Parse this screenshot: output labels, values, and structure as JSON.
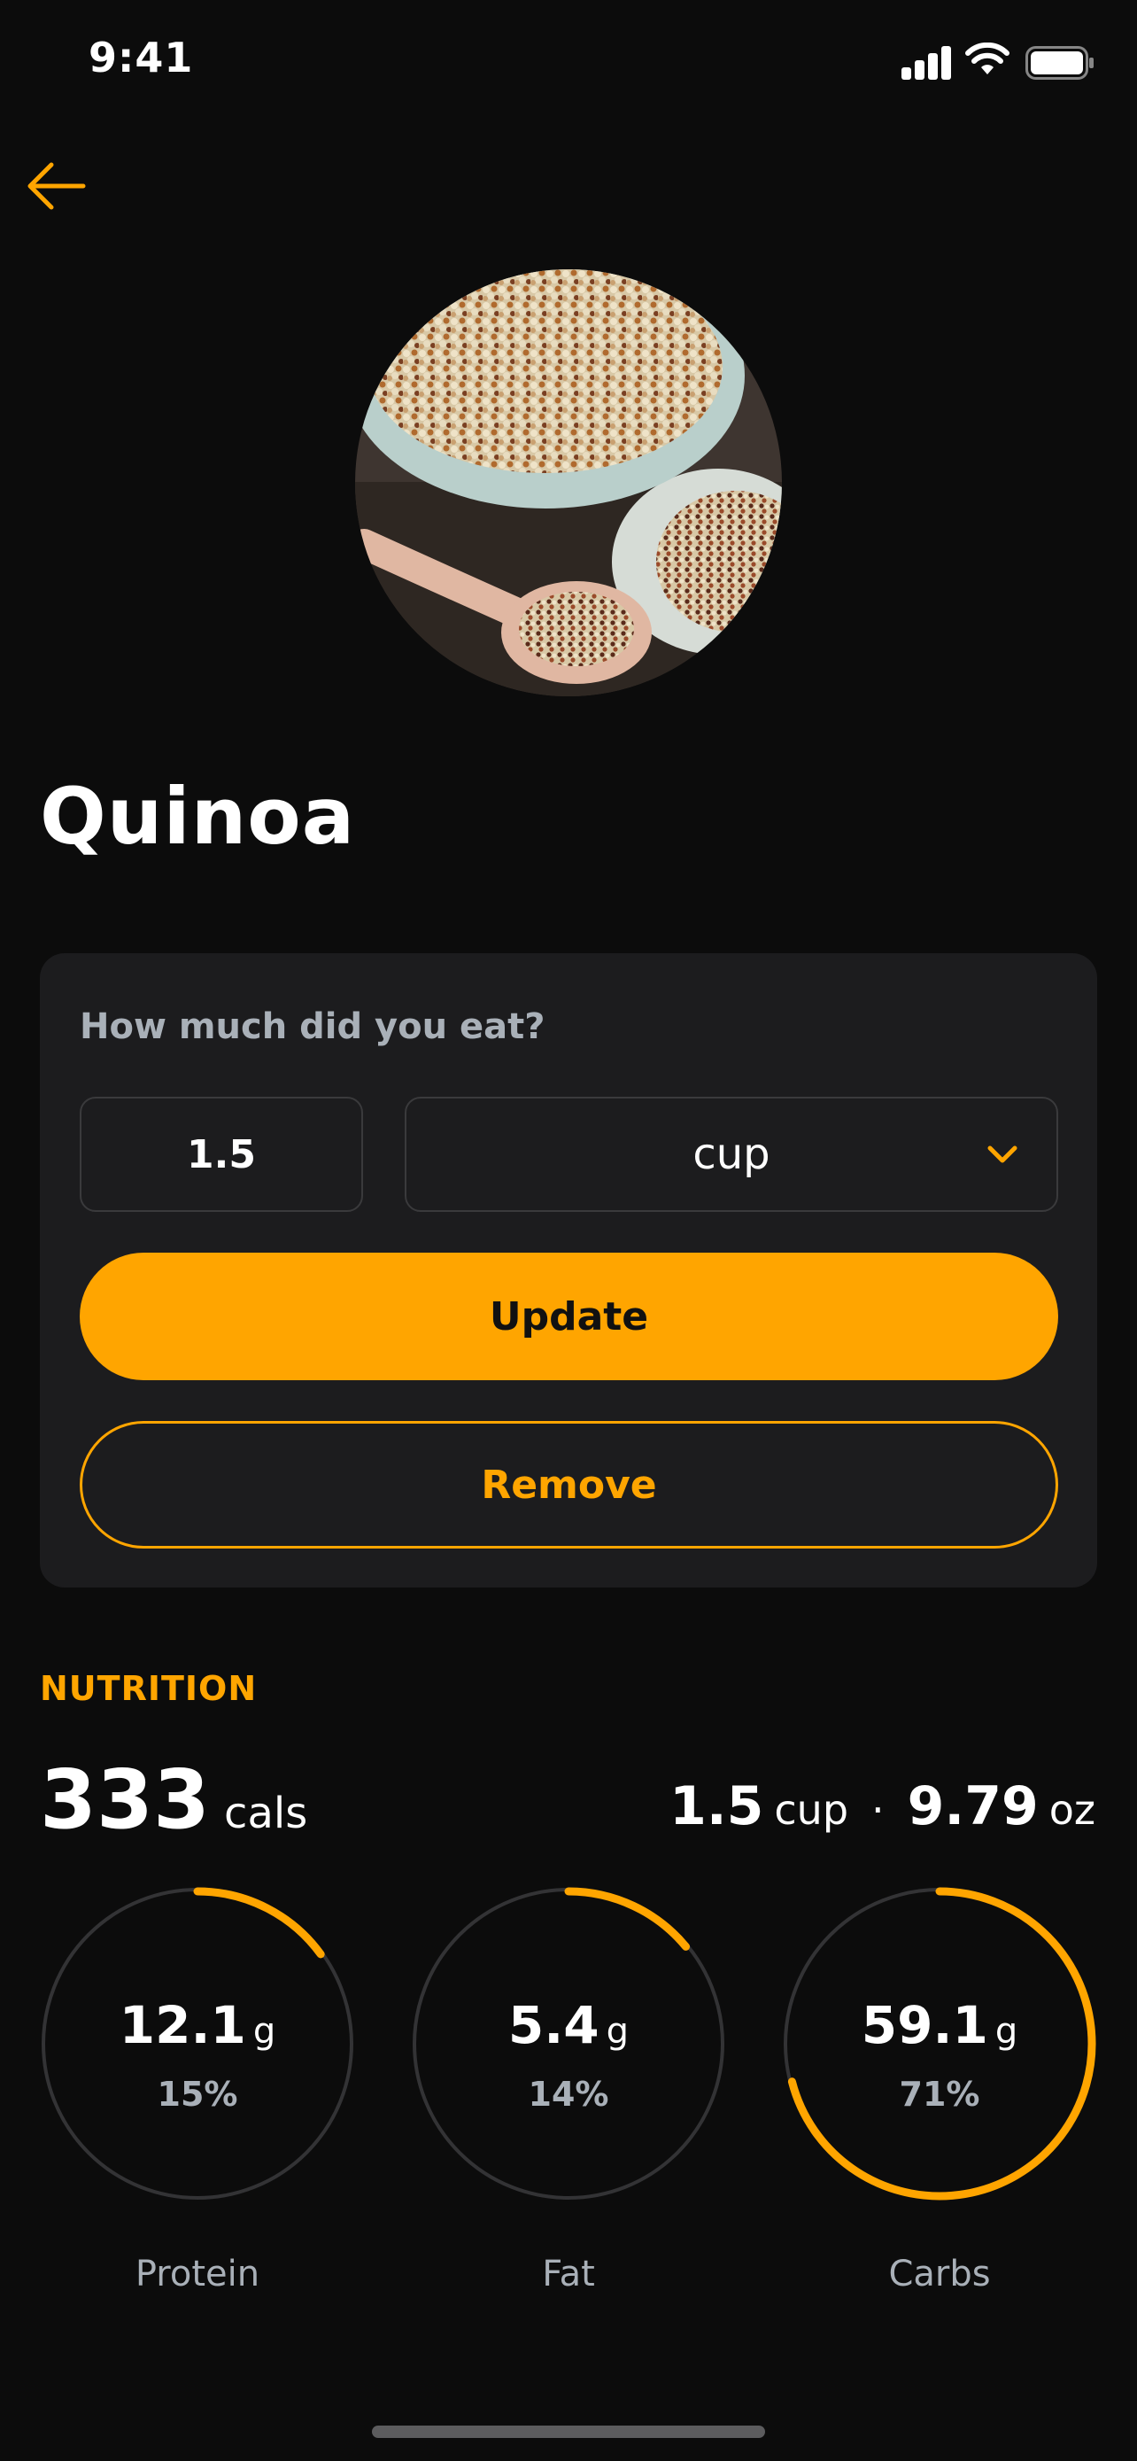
{
  "status_bar": {
    "time": "9:41"
  },
  "food": {
    "name": "Quinoa",
    "image": "quinoa-bowl-photo"
  },
  "portion": {
    "question": "How much did you eat?",
    "quantity": "1.5",
    "unit": "cup",
    "update_label": "Update",
    "remove_label": "Remove"
  },
  "nutrition": {
    "heading": "NUTRITION",
    "calories": "333",
    "calories_unit": "cals",
    "serving_amount": "1.5",
    "serving_unit": "cup",
    "separator": "·",
    "weight_amount": "9.79",
    "weight_unit": "oz",
    "macros": [
      {
        "name": "Protein",
        "amount": "12.1",
        "unit": "g",
        "percent_label": "15%",
        "fraction": 0.15
      },
      {
        "name": "Fat",
        "amount": "5.4",
        "unit": "g",
        "percent_label": "14%",
        "fraction": 0.14
      },
      {
        "name": "Carbs",
        "amount": "59.1",
        "unit": "g",
        "percent_label": "71%",
        "fraction": 0.71
      }
    ]
  },
  "colors": {
    "accent": "#ffa500",
    "background": "#0c0c0c",
    "card": "#1c1c1e",
    "muted": "#a9b0b8",
    "ring_track": "#333335"
  }
}
